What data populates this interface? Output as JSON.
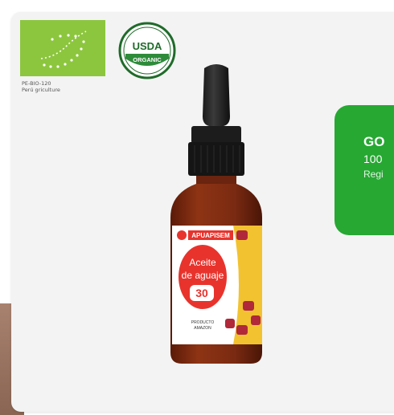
{
  "eu_logo": {
    "code_line1": "PE-BIO-120",
    "code_line2": "Perú griculture"
  },
  "usda_seal": {
    "top_text": "USDA",
    "bottom_text": "ORGANIC"
  },
  "product": {
    "brand": "APUAPISEM",
    "name_line1": "Aceite",
    "name_line2": "de aguaje",
    "volume": "30",
    "tagline_line1": "PRODUCTO",
    "tagline_line2": "AMAZON"
  },
  "promo": {
    "title": "GO",
    "subtitle": "100",
    "note": "Regi"
  },
  "colors": {
    "eu_green": "#8cc63e",
    "usda_green": "#2e8b3a",
    "promo_green": "#26a832",
    "label_red": "#e8332c",
    "oil_amber": "#7a2a12"
  }
}
